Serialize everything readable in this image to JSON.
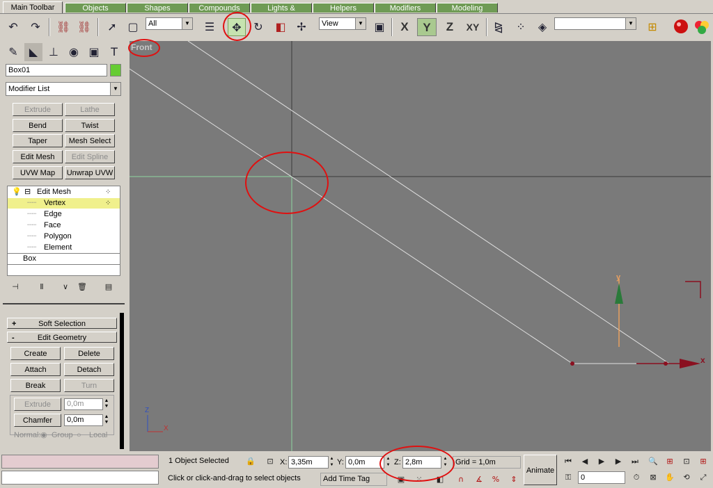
{
  "tabs": [
    "Main Toolbar",
    "Objects",
    "Shapes",
    "Compounds",
    "Lights & Cameras",
    "Helpers",
    "Modifiers",
    "Modeling"
  ],
  "toolbar": {
    "selection_filter": "All",
    "ref_coord": "View",
    "axis_x": "X",
    "axis_y": "Y",
    "axis_z": "Z",
    "axis_xy": "XY",
    "named_selection": ""
  },
  "command_panel": {
    "object_name": "Box01",
    "object_color": "#66cc33",
    "modifier_list": "Modifier List",
    "modifier_buttons": [
      {
        "label": "Extrude",
        "enabled": false
      },
      {
        "label": "Lathe",
        "enabled": false
      },
      {
        "label": "Bend",
        "enabled": true
      },
      {
        "label": "Twist",
        "enabled": true
      },
      {
        "label": "Taper",
        "enabled": true
      },
      {
        "label": "Mesh Select",
        "enabled": true
      },
      {
        "label": "Edit Mesh",
        "enabled": true
      },
      {
        "label": "Edit Spline",
        "enabled": false
      },
      {
        "label": "UVW Map",
        "enabled": true
      },
      {
        "label": "Unwrap UVW",
        "enabled": true
      }
    ],
    "stack": {
      "edit_mesh": "Edit Mesh",
      "vertex": "Vertex",
      "edge": "Edge",
      "face": "Face",
      "polygon": "Polygon",
      "element": "Element",
      "base": "Box"
    },
    "rollouts": {
      "soft_selection": "Soft Selection",
      "soft_selection_sign": "+",
      "edit_geometry": "Edit Geometry",
      "edit_geometry_sign": "-"
    },
    "edit_geometry": {
      "create": "Create",
      "delete": "Delete",
      "attach": "Attach",
      "detach": "Detach",
      "break": "Break",
      "turn": "Turn",
      "extrude": "Extrude",
      "extrude_value": "0,0m",
      "chamfer": "Chamfer",
      "chamfer_value": "0,0m",
      "normal_label": "Normal:",
      "group": "Group",
      "local": "Local"
    }
  },
  "viewport": {
    "label": "Front",
    "gizmo_x": "x",
    "gizmo_y": "y",
    "axes_x": "X",
    "axes_z": "Z"
  },
  "status": {
    "selected": "1 Object Selected",
    "prompt": "Click or click-and-drag to select objects",
    "add_time_tag": "Add Time Tag",
    "x_label": "X:",
    "x_value": "3,35m",
    "y_label": "Y:",
    "y_value": "0,0m",
    "z_label": "Z:",
    "z_value": "2,8m",
    "grid": "Grid = 1,0m",
    "animate": "Animate",
    "frame": "0"
  }
}
